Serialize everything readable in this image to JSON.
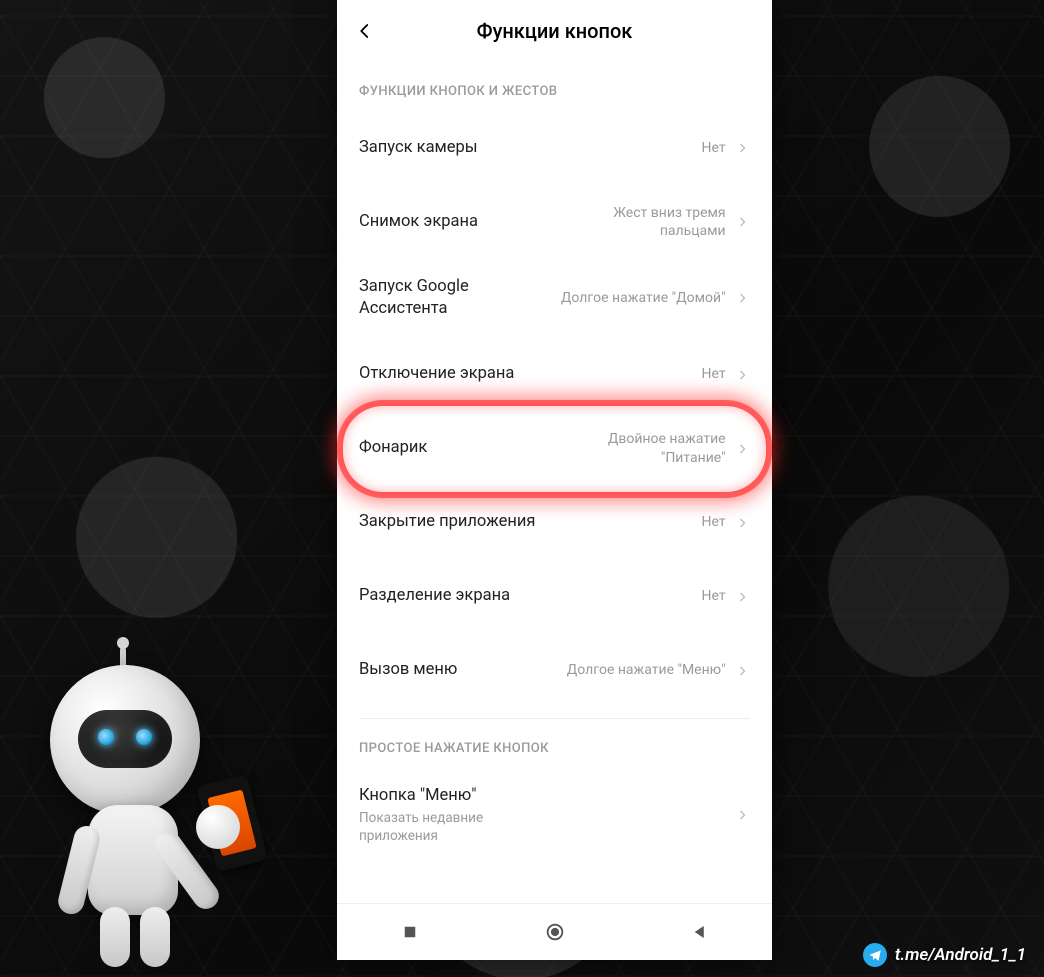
{
  "header": {
    "title": "Функции кнопок"
  },
  "sections": {
    "gestures": {
      "header": "ФУНКЦИИ КНОПОК И ЖЕСТОВ",
      "rows": {
        "camera": {
          "label": "Запуск камеры",
          "value": "Нет"
        },
        "screenshot": {
          "label": "Снимок экрана",
          "value": "Жест вниз тремя пальцами"
        },
        "assistant": {
          "label": "Запуск Google Ассистента",
          "value": "Долгое нажатие \"Домой\""
        },
        "screen_off": {
          "label": "Отключение экрана",
          "value": "Нет"
        },
        "flashlight": {
          "label": "Фонарик",
          "value": "Двойное нажатие \"Питание\""
        },
        "close_app": {
          "label": "Закрытие приложения",
          "value": "Нет"
        },
        "split_screen": {
          "label": "Разделение экрана",
          "value": "Нет"
        },
        "menu_call": {
          "label": "Вызов меню",
          "value": "Долгое нажатие \"Меню\""
        }
      }
    },
    "simple": {
      "header": "ПРОСТОЕ НАЖАТИЕ КНОПОК",
      "rows": {
        "menu_button": {
          "label": "Кнопка \"Меню\"",
          "sub": "Показать недавние приложения"
        }
      }
    }
  },
  "watermark": {
    "text": "t.me/Android_1_1"
  }
}
